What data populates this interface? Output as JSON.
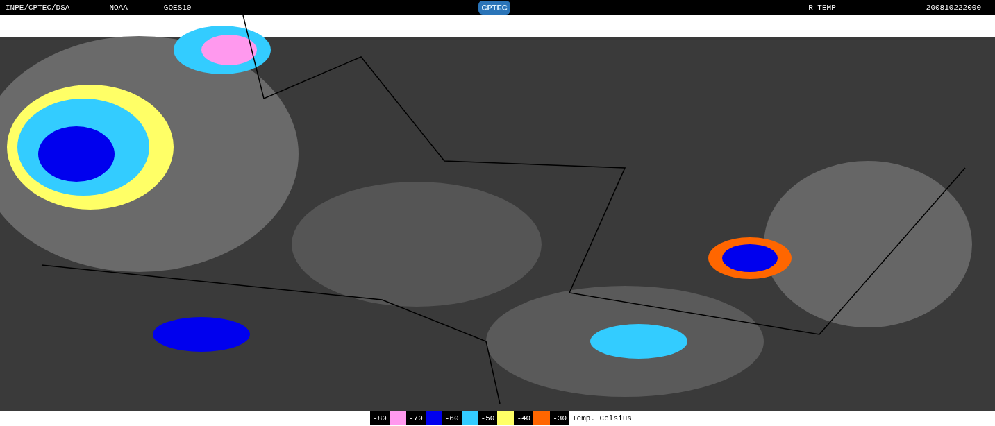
{
  "header": {
    "left": [
      "INPE/CPTEC/DSA",
      "NOAA",
      "GOES10"
    ],
    "logo": "CPTEC",
    "product": "R_TEMP",
    "timestamp": "200810222000"
  },
  "legend": {
    "bins": [
      {
        "label": "-80",
        "color": "#ff99ee"
      },
      {
        "label": "-70",
        "color": "#0000ee"
      },
      {
        "label": "-60",
        "color": "#33ccff"
      },
      {
        "label": "-50",
        "color": "#ffff66"
      },
      {
        "label": "-40",
        "color": "#ff6600"
      },
      {
        "label": "-30"
      }
    ],
    "title": "Temp. Celsius"
  }
}
